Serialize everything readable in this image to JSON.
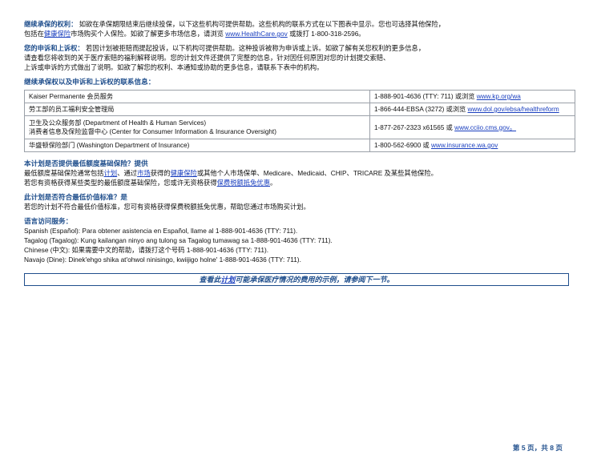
{
  "continuation": {
    "heading": "继续承保的权利：",
    "text_1": "如欲在承保期限结束后继续投保，以下这些机构可提供帮助。这些机构的联系方式在以下图表中显示。您也可选择其他保险，",
    "text_2": "包括在",
    "link_health_insurance": "健康保险",
    "text_3": "市场购买个人保险。如欲了解更多市场信息，请浏览",
    "link_healthcare": "www.HealthCare.gov",
    "text_4": "或拨打 1-800-318-2596。"
  },
  "grievance": {
    "heading": "您的申诉和上诉权：",
    "line_1": "若因计划被拒赔而提起投诉，以下机构可提供帮助。这种投诉被称为申诉或上诉。如欲了解有关您权利的更多信息，",
    "line_2": "请查看您将收到的关于医疗索赔的福利解释说明。您的计划文件还提供了完整的信息，针对因任何原因对您的计划提交索赔、",
    "line_3": "上诉或申诉的方式做出了说明。如欲了解您的权利、本通知或协助的更多信息，请联系下表中的机构。"
  },
  "contacts": {
    "title": "继续承保权以及申诉和上诉权的联系信息：",
    "rows": [
      {
        "org": "Kaiser Permanente 会员服务",
        "contact_prefix": "1-888-901-4636 (TTY: 711) 或浏览 ",
        "link": "www.kp.org/wa"
      },
      {
        "org": "劳工部的员工福利安全管理局",
        "contact_prefix": "1-866-444-EBSA (3272) 或浏览 ",
        "link": "www.dol.gov/ebsa/healthreform"
      },
      {
        "org_line_1": "卫生及公众服务部 (Department of Health & Human Services)",
        "org_line_2": "消费者信息及保险监督中心 (Center for Consumer Information & Insurance Oversight)",
        "contact_prefix": "1-877-267-2323 x61565 或 ",
        "link": "www.cciio.cms.gov。"
      },
      {
        "org": "华盛顿保险部门 (Washington Department of Insurance)",
        "contact_prefix": "1-800-562-6900 或 ",
        "link": "www.insurance.wa.gov"
      }
    ]
  },
  "mec": {
    "title": "本计划是否提供最低额度基础保险？提供",
    "text_1": "最低额度基础保险通常包括",
    "link_plan": "计划",
    "text_2": "、通过",
    "link_market": "市场",
    "text_3": "获得的",
    "link_health_insurance": "健康保险",
    "text_4": "或其他个人市场保单、Medicare、Medicaid、CHIP、TRICARE 及某些其他保险。",
    "text_5": "若您有资格获得某些类型的最低额度基础保险，您或许无资格获得",
    "link_tax_credit": "保费税额抵免优惠",
    "text_6": "。"
  },
  "mvs": {
    "title": "此计划是否符合最低价值标准？是",
    "text": "若您的计划不符合最低价值标准，您可有资格获得保费税额抵免优惠，帮助您通过市场购买计划。"
  },
  "language": {
    "title": "语言访问服务：",
    "lines": [
      "Spanish (Español): Para obtener asistencia en Español, llame al 1-888-901-4636 (TTY: 711).",
      "Tagalog (Tagalog): Kung kailangan ninyo ang tulong sa Tagalog tumawag sa 1-888-901-4636 (TTY: 711).",
      "Chinese (中文): 如果需要中文的帮助，请拨打这个号码 1-888-901-4636 (TTY: 711).",
      "Navajo (Dine): Dinek'ehgo shika at'ohwol ninisingo, kwiijigo holne' 1-888-901-4636 (TTY: 711)."
    ]
  },
  "callout": {
    "text_1": "查看此",
    "link_plan": "计划",
    "text_2": "可能承保医疗情况的费用的示例，请参阅下一节。"
  },
  "footer": {
    "page_number": "第 5 页，共 8 页"
  },
  "colors": {
    "heading_blue": "#1f4e8c",
    "link_blue": "#1a3fbf"
  }
}
